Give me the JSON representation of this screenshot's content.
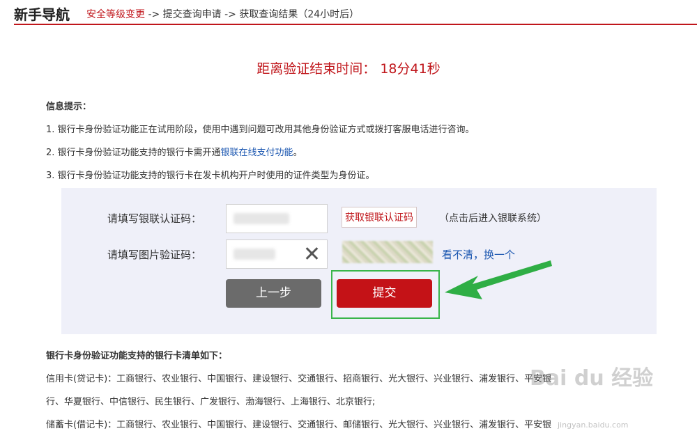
{
  "header": {
    "title": "新手导航",
    "steps": [
      "安全等级变更",
      " -> 提交查询申请 -> 获取查询结果（24小时后）"
    ]
  },
  "countdown": {
    "label": "距离验证结束时间：",
    "value": "18分41秒"
  },
  "info": {
    "heading": "信息提示：",
    "line1": "1. 银行卡身份验证功能正在试用阶段，使用中遇到问题可改用其他身份验证方式或拨打客服电话进行咨询。",
    "line2_prefix": "2. 银行卡身份验证功能支持的银行卡需开通",
    "line2_link": "银联在线支付功能",
    "line2_suffix": "。",
    "line3": "3. 银行卡身份验证功能支持的银行卡在发卡机构开户时使用的证件类型为身份证。"
  },
  "form": {
    "unionpay_label": "请填写银联认证码：",
    "get_code_button": "获取银联认证码",
    "get_code_hint": "（点击后进入银联系统）",
    "captcha_label": "请填写图片验证码：",
    "refresh_captcha": "看不清，换一个",
    "prev_button": "上一步",
    "submit_button": "提交"
  },
  "banks": {
    "heading": "银行卡身份验证功能支持的银行卡清单如下：",
    "credit_row1": "信用卡(贷记卡)：工商银行、农业银行、中国银行、建设银行、交通银行、招商银行、光大银行、兴业银行、浦发银行、平安银",
    "credit_row2": "行、华夏银行、中信银行、民生银行、广发银行、渤海银行、上海银行、北京银行;",
    "debit_row1": "储蓄卡(借记卡)：工商银行、农业银行、中国银行、建设银行、交通银行、邮储银行、光大银行、兴业银行、浦发银行、平安银"
  },
  "watermark": {
    "logo": "Bai du 经验",
    "url": "jingyan.baidu.com"
  },
  "colors": {
    "accent": "#c0161b",
    "link": "#1a56b0",
    "highlight": "#39b54a"
  }
}
